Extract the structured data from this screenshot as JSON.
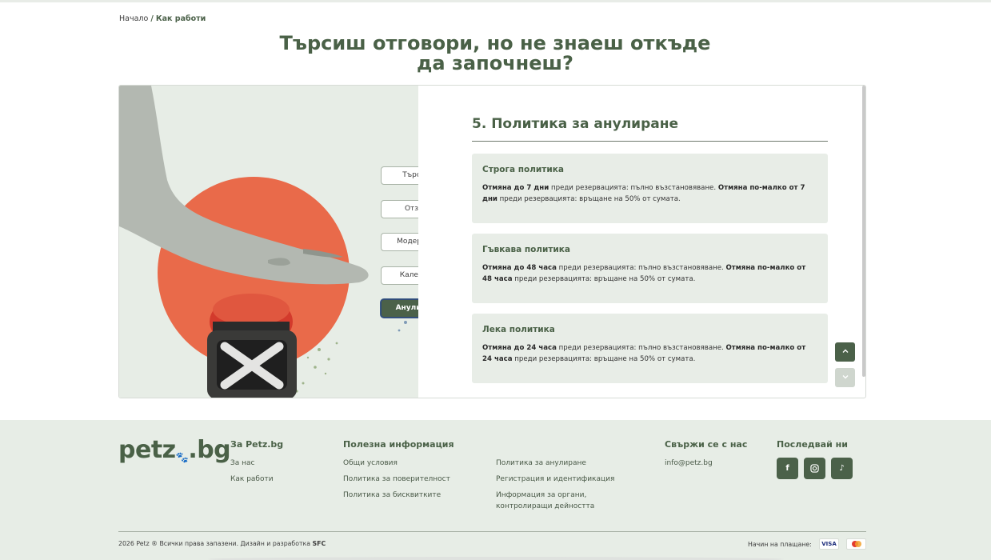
{
  "breadcrumb": {
    "home": "Начало",
    "separator": "/",
    "current": "Как работи"
  },
  "hero": {
    "title": "Търсиш отговори, но не знаеш откъде да започнеш?"
  },
  "menu": {
    "items": [
      {
        "label": "Търсене",
        "active": false
      },
      {
        "label": "Отзиви",
        "active": false
      },
      {
        "label": "Модерация",
        "active": false
      },
      {
        "label": "Календар",
        "active": false
      },
      {
        "label": "Анулиране",
        "active": true
      }
    ]
  },
  "section": {
    "title": "5. Политика за анулиране",
    "policies": [
      {
        "title": "Строга политика",
        "b1": "Отмяна до 7 дни",
        "t1": " преди резервацията: пълно възстановяване. ",
        "b2": "Отмяна по-малко от 7 дни",
        "t2": " преди резервацията: връщане на 50% от сумата."
      },
      {
        "title": "Гъвкава политика",
        "b1": "Отмяна до 48 часа",
        "t1": " преди резервацията: пълно възстановяване. ",
        "b2": "Отмяна по-малко от 48 часа",
        "t2": " преди резервацията: връщане на 50% от сумата."
      },
      {
        "title": "Лека политика",
        "b1": "Отмяна до 24 часа",
        "t1": " преди резервацията: пълно възстановяване. ",
        "b2": "Отмяна по-малко от 24 часа",
        "t2": " преди резервацията: връщане на 50% от сумата."
      }
    ]
  },
  "scroll": {
    "up_icon": "chevron-up-icon",
    "down_icon": "chevron-down-icon"
  },
  "footer": {
    "logo": "petz",
    "logo_suffix": ".bg",
    "col_about": {
      "title": "За Petz.bg",
      "links": [
        "За нас",
        "Как работи"
      ]
    },
    "col_info": {
      "title": "Полезна информация",
      "links_left": [
        "Общи условия",
        "Политика за поверителност",
        "Политика за бисквитките"
      ],
      "links_right": [
        "Политика за анулиране",
        "Регистрация и идентификация",
        "Информация за органи, контролиращи дейността"
      ]
    },
    "col_contact": {
      "title": "Свържи се с нас",
      "email": "info@petz.bg"
    },
    "col_follow": {
      "title": "Последвай ни",
      "icons": [
        "facebook-icon",
        "instagram-icon",
        "tiktok-icon"
      ]
    },
    "copyright": "2026 Petz ® Всички права запазени. Дизайн и разработка ",
    "copyright_brand": "SFC",
    "payment_label": "Начин на плащане:",
    "payment_visa": "VISA"
  },
  "colors": {
    "brand_green": "#4b6149",
    "accent_orange": "#e96a4a",
    "panel_bg": "#e8ede7"
  }
}
